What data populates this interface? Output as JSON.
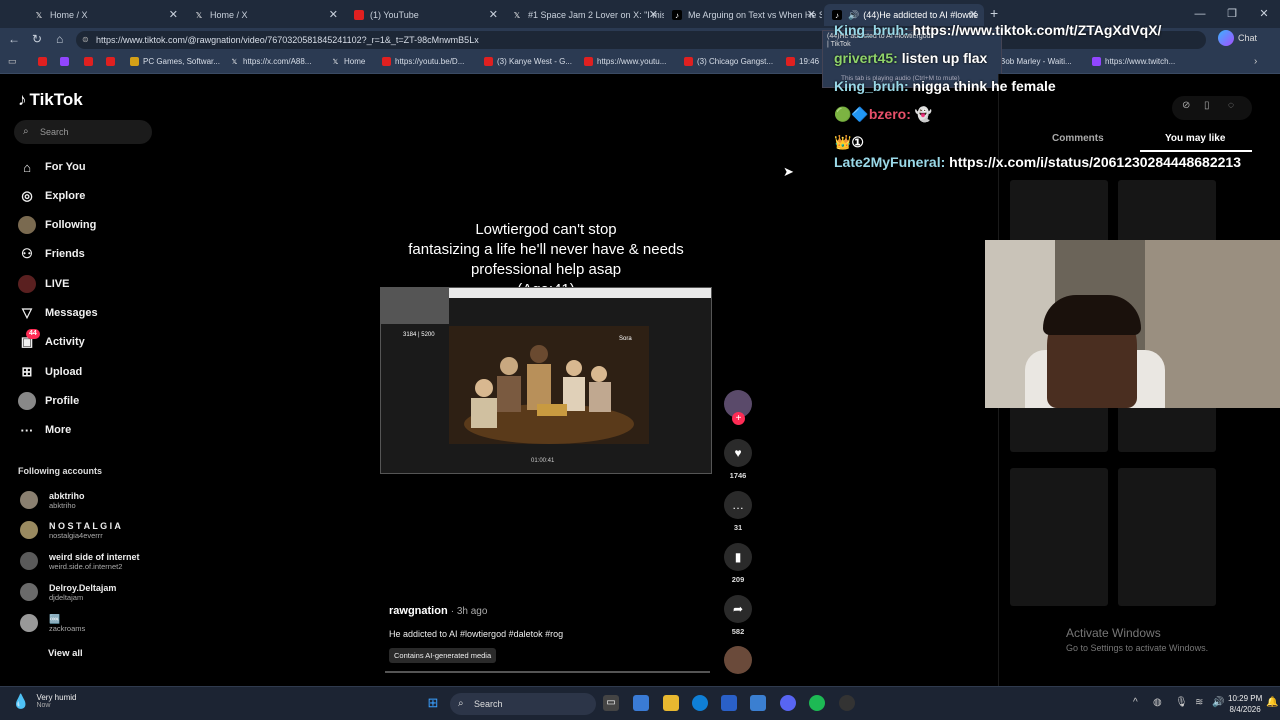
{
  "tabs": [
    {
      "label": "Home / X",
      "icon": "x"
    },
    {
      "label": "Home / X",
      "icon": "x"
    },
    {
      "label": "(1) YouTube",
      "icon": "yt"
    },
    {
      "label": "#1 Space Jam 2 Lover on X: \"I mis",
      "icon": "x"
    },
    {
      "label": "Me Arguing on Text vs When He S",
      "icon": "tt"
    },
    {
      "label": "(44)He addicted to AI #lowtie",
      "icon": "tt"
    }
  ],
  "browser": {
    "url": "https://www.tiktok.com/@rawgnation/video/7670320581845241102?_r=1&_t=ZT-98cMnwmB5Lx",
    "chat_label": "Chat"
  },
  "bookmarks": [
    "PC Games, Softwar...",
    "https://x.com/A88...",
    "Home",
    "https://youtu.be/D...",
    "(3) Kanye West - G...",
    "https://www.youtu...",
    "(3) Chicago Gangst...",
    "19:46",
    "Bob Marley - Waiti...",
    "https://www.twitch..."
  ],
  "tooltip": {
    "line1": "(44)He addicted to AI #lowtiergod",
    "line2": "| TikTok",
    "line3": "This tab is playing audio (Ctrl+M to mute)"
  },
  "sidebar": {
    "logo": "TikTok",
    "search_placeholder": "Search",
    "nav": [
      {
        "label": "For You",
        "icon": "home-icon"
      },
      {
        "label": "Explore",
        "icon": "compass-icon"
      },
      {
        "label": "Following",
        "icon": "following-icon"
      },
      {
        "label": "Friends",
        "icon": "friends-icon"
      },
      {
        "label": "LIVE",
        "icon": "live-icon"
      },
      {
        "label": "Messages",
        "icon": "messages-icon"
      },
      {
        "label": "Activity",
        "icon": "activity-icon",
        "badge": "44"
      },
      {
        "label": "Upload",
        "icon": "upload-icon"
      },
      {
        "label": "Profile",
        "icon": "profile-icon"
      },
      {
        "label": "More",
        "icon": "more-icon"
      }
    ],
    "following_title": "Following accounts",
    "accounts": [
      {
        "name": "abktriho",
        "handle": "abktriho"
      },
      {
        "name": "N O S T A L G I A",
        "handle": "nostalgia4everrr"
      },
      {
        "name": "weird side of internet",
        "handle": "weird.side.of.internet2"
      },
      {
        "name": "Delroy.Deltajam",
        "handle": "djdeltajam"
      },
      {
        "name": "🆒",
        "handle": "zackroams"
      }
    ],
    "view_all": "View all"
  },
  "video": {
    "caption_lines": [
      "Lowtiergod can't stop",
      "fantasizing a life he'll never have & needs",
      "professional help asap",
      "(Age:41)"
    ],
    "inner_score": "3184 | 5200",
    "inner_sora": "Sora",
    "inner_time": "01:00:41",
    "author": "rawgnation",
    "time_ago": "· 3h ago",
    "description": "He addicted to AI #lowtiergod #daletok #rog",
    "ai_tag": "Contains AI-generated media",
    "likes": "1746",
    "comments": "31",
    "saves": "209",
    "shares": "582"
  },
  "right_panel": {
    "tab_comments": "Comments",
    "tab_you_may_like": "You may like"
  },
  "stream_chat": [
    {
      "user": "King_bruh:",
      "msg": "https://www.tiktok.com/t/ZTAgXdVqX/",
      "color": "u"
    },
    {
      "user": "grivert45:",
      "msg": "listen up flax",
      "color": "ug"
    },
    {
      "user": "King_bruh:",
      "msg": "nigga think he female",
      "color": "u"
    },
    {
      "user": "bzero:",
      "msg": "👻",
      "color": "ur"
    },
    {
      "user": "Late2MyFuneral:",
      "msg": "https://x.com/i/status/2061230284448682213",
      "color": "u"
    }
  ],
  "watermark": {
    "line1": "Activate Windows",
    "line2": "Go to Settings to activate Windows."
  },
  "taskbar": {
    "weather": "Very humid",
    "weather_sub": "Now",
    "search": "Search",
    "time": "10:29 PM",
    "date": "8/4/2026"
  }
}
